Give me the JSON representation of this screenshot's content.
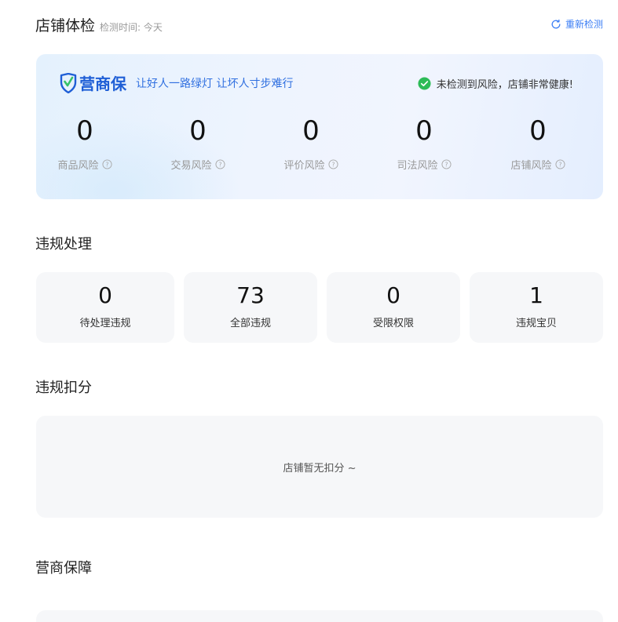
{
  "health": {
    "title": "店铺体检",
    "check_time": "检测时间: 今天",
    "recheck_label": "重新检测",
    "brand_name": "营商保",
    "brand_slogan": "让好人一路绿灯 让坏人寸步难行",
    "status_text": "未检测到风险，店铺非常健康!",
    "risks": [
      {
        "value": "0",
        "label": "商品风险"
      },
      {
        "value": "0",
        "label": "交易风险"
      },
      {
        "value": "0",
        "label": "评价风险"
      },
      {
        "value": "0",
        "label": "司法风险"
      },
      {
        "value": "0",
        "label": "店铺风险"
      }
    ]
  },
  "violation_handling": {
    "title": "违规处理",
    "stats": [
      {
        "value": "0",
        "label": "待处理违规"
      },
      {
        "value": "73",
        "label": "全部违规"
      },
      {
        "value": "0",
        "label": "受限权限"
      },
      {
        "value": "1",
        "label": "违规宝贝"
      }
    ]
  },
  "deduction": {
    "title": "违规扣分",
    "empty_text": "店铺暂无扣分 ~"
  },
  "protection": {
    "title": "营商保障"
  },
  "colors": {
    "accent": "#3d7ff5",
    "brand": "#1f5fd6",
    "success": "#2dbb57"
  },
  "icons": {
    "recheck": "refresh-icon",
    "brand": "shield-logo-icon",
    "status": "check-circle-icon",
    "help": "question-circle-icon"
  }
}
